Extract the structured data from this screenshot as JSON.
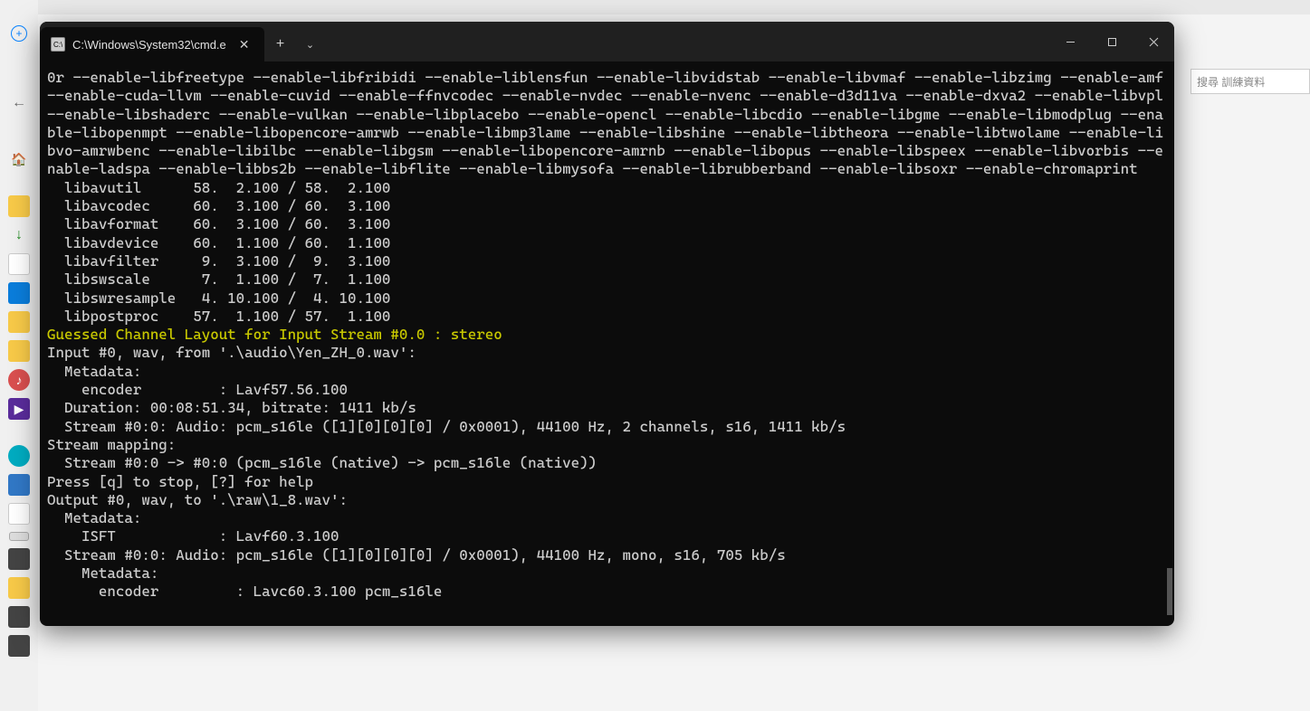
{
  "search_placeholder": "搜尋 訓練資料",
  "tab_title": "C:\\Windows\\System32\\cmd.e",
  "term": {
    "config_flags": "0r --enable-libfreetype --enable-libfribidi --enable-liblensfun --enable-libvidstab --enable-libvmaf --enable-libzimg --enable-amf --enable-cuda-llvm --enable-cuvid --enable-ffnvcodec --enable-nvdec --enable-nvenc --enable-d3d11va --enable-dxva2 --enable-libvpl --enable-libshaderc --enable-vulkan --enable-libplacebo --enable-opencl --enable-libcdio --enable-libgme --enable-libmodplug --enable-libopenmpt --enable-libopencore-amrwb --enable-libmp3lame --enable-libshine --enable-libtheora --enable-libtwolame --enable-libvo-amrwbenc --enable-libilbc --enable-libgsm --enable-libopencore-amrnb --enable-libopus --enable-libspeex --enable-libvorbis --enable-ladspa --enable-libbs2b --enable-libflite --enable-libmysofa --enable-librubberband --enable-libsoxr --enable-chromaprint",
    "libavutil": "  libavutil      58.  2.100 / 58.  2.100",
    "libavcodec": "  libavcodec     60.  3.100 / 60.  3.100",
    "libavformat": "  libavformat    60.  3.100 / 60.  3.100",
    "libavdevice": "  libavdevice    60.  1.100 / 60.  1.100",
    "libavfilter": "  libavfilter     9.  3.100 /  9.  3.100",
    "libswscale": "  libswscale      7.  1.100 /  7.  1.100",
    "libswresample": "  libswresample   4. 10.100 /  4. 10.100",
    "libpostproc": "  libpostproc    57.  1.100 / 57.  1.100",
    "guessed": "Guessed Channel Layout for Input Stream #0.0 : stereo",
    "input0": "Input #0, wav, from '.\\audio\\Yen_ZH_0.wav':",
    "meta1": "  Metadata:",
    "encoder1": "    encoder         : Lavf57.56.100",
    "duration": "  Duration: 00:08:51.34, bitrate: 1411 kb/s",
    "stream_in": "  Stream #0:0: Audio: pcm_s16le ([1][0][0][0] / 0x0001), 44100 Hz, 2 channels, s16, 1411 kb/s",
    "mapping": "Stream mapping:",
    "map1": "  Stream #0:0 -> #0:0 (pcm_s16le (native) -> pcm_s16le (native))",
    "press": "Press [q] to stop, [?] for help",
    "output0": "Output #0, wav, to '.\\raw\\1_8.wav':",
    "meta2": "  Metadata:",
    "isft": "    ISFT            : Lavf60.3.100",
    "stream_out": "  Stream #0:0: Audio: pcm_s16le ([1][0][0][0] / 0x0001), 44100 Hz, mono, s16, 705 kb/s",
    "meta3": "    Metadata:",
    "encoder2": "      encoder         : Lavc60.3.100 pcm_s16le"
  }
}
